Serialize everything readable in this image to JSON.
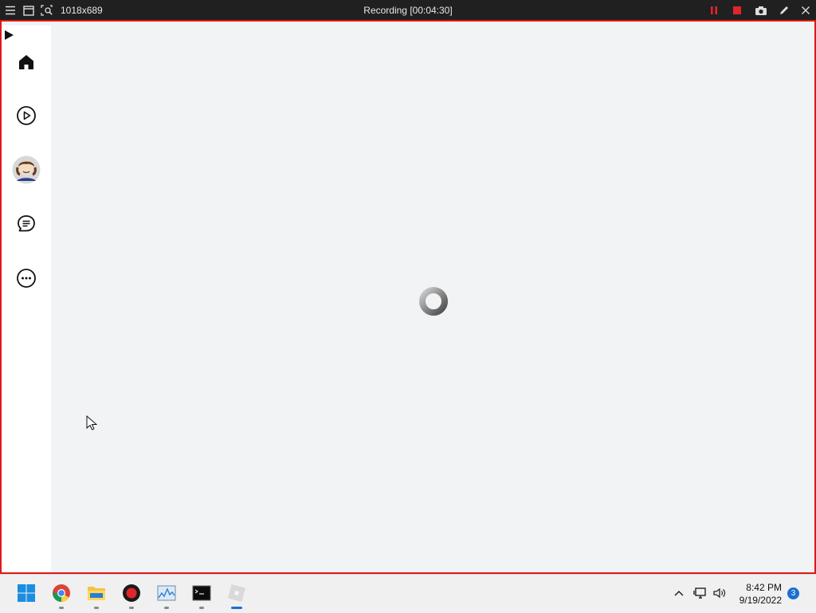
{
  "recorder": {
    "size_label": "1018x689",
    "title": "Recording [00:04:30]",
    "colors": {
      "bar": "#202020",
      "frame": "#e01818",
      "accent_red": "#e0252b"
    }
  },
  "app": {
    "sidebar_icons": [
      "home-icon",
      "play-icon",
      "avatar",
      "chat-icon",
      "more-icon"
    ],
    "background": "#f2f3f5",
    "state": "loading"
  },
  "taskbar": {
    "apps": [
      "start-icon",
      "chrome-icon",
      "file-explorer-icon",
      "record-icon",
      "resource-monitor-icon",
      "terminal-icon",
      "roblox-icon"
    ],
    "clock": {
      "time": "8:42 PM",
      "date": "9/19/2022"
    },
    "notifications": "3"
  }
}
